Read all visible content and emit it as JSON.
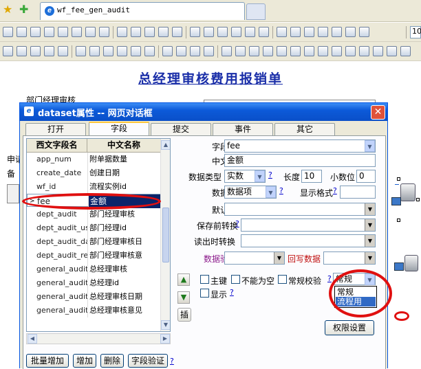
{
  "browser": {
    "tab_title": "wf_fee_gen_audit"
  },
  "toolbar2": {
    "zoom_value": "10"
  },
  "document": {
    "title": "总经理审核费用报销单",
    "bg_label_dept": "部门经理审核",
    "bg_label_1": "申请",
    "bg_label_2": "备"
  },
  "dialog": {
    "title": "dataset属性 -- 网页对话框",
    "close_glyph": "✕",
    "tabs": [
      "打开",
      "字段",
      "提交",
      "事件",
      "其它"
    ],
    "grid": {
      "headers": [
        "西文字段名",
        "中文名称"
      ],
      "rows": [
        {
          "en": "app_num",
          "cn": "附单据数量"
        },
        {
          "en": "create_date",
          "cn": "创建日期"
        },
        {
          "en": "wf_id",
          "cn": "流程实例id"
        },
        {
          "en": "fee",
          "cn": "金额"
        },
        {
          "en": "dept_audit",
          "cn": "部门经理审核"
        },
        {
          "en": "dept_audit_use",
          "cn": "部门经理id"
        },
        {
          "en": "dept_audit_dat",
          "cn": "部门经理审核日"
        },
        {
          "en": "dept_audit_ren",
          "cn": "部门经理审核意"
        },
        {
          "en": "general_audit",
          "cn": "总经理审核"
        },
        {
          "en": "general_audit_",
          "cn": "总经理id"
        },
        {
          "en": "general_audit_",
          "cn": "总经理审核日期"
        },
        {
          "en": "general_audit_",
          "cn": "总经理审核意见"
        }
      ],
      "selected_index": 3
    },
    "buttons": {
      "batch_add": "批量增加",
      "add": "增加",
      "delete": "删除",
      "validate": "字段验证",
      "insert": "插",
      "permissions": "权限设置",
      "help": "?"
    },
    "form": {
      "field_name_label": "字段名",
      "field_name_value": "fee",
      "cn_name_label": "中文名",
      "cn_name_value": "金额",
      "data_type_label": "数据类型",
      "data_type_value": "实数",
      "length_label": "长度",
      "length_value": "10",
      "decimals_label": "小数位",
      "decimals_value": "0",
      "data_item_label": "数据项",
      "data_item_value": "数据项",
      "display_format_label": "显示格式",
      "default_label": "默认值",
      "pre_save_label": "保存前转换",
      "post_read_label": "读出时转换",
      "validation_label": "数据验证",
      "writeback_label": "回写数据",
      "primary_key_label": "主键",
      "not_null_label": "不能为空",
      "normal_check_label": "常规校验",
      "display_label": "显示",
      "check_type_value": "常规",
      "check_type_options": [
        "常规",
        "流程用"
      ],
      "check_type_highlighted": 1
    }
  },
  "colors": {
    "dialog_title": "#0a4fc8",
    "selection": "#0a246a",
    "doc_title": "#1a2ea8",
    "annotation_red": "#e01010",
    "validation_label": "#8b1a8b"
  }
}
